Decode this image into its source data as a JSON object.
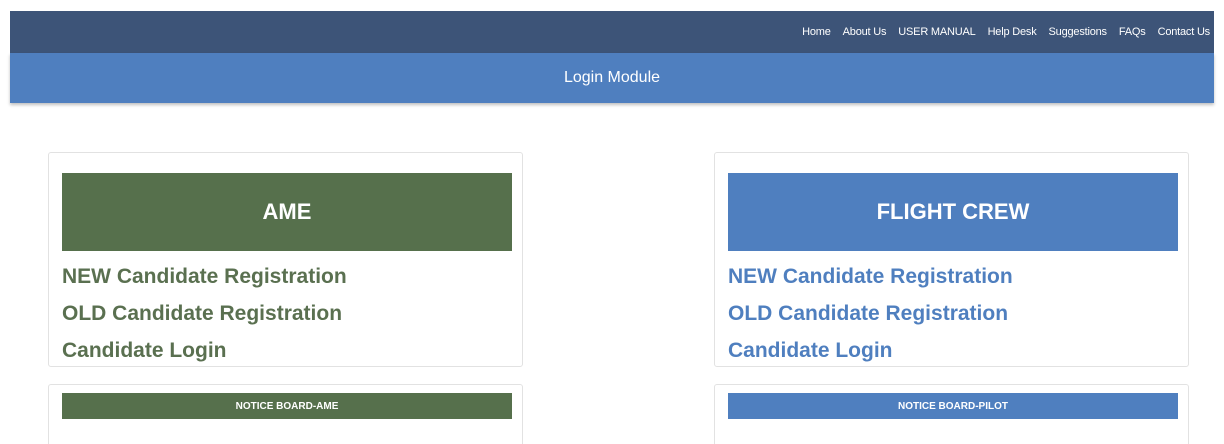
{
  "nav": {
    "items": [
      {
        "label": "Home"
      },
      {
        "label": "About Us"
      },
      {
        "label": "USER MANUAL"
      },
      {
        "label": "Help Desk"
      },
      {
        "label": "Suggestions"
      },
      {
        "label": "FAQs"
      },
      {
        "label": "Contact Us"
      }
    ]
  },
  "module_bar": {
    "title": "Login Module"
  },
  "ame": {
    "title": "AME",
    "links": [
      {
        "label": "NEW Candidate Registration"
      },
      {
        "label": "OLD Candidate Registration"
      },
      {
        "label": "Candidate Login"
      }
    ],
    "notice_title": "NOTICE BOARD-AME"
  },
  "flight_crew": {
    "title": "FLIGHT CREW",
    "links": [
      {
        "label": "NEW Candidate Registration"
      },
      {
        "label": "OLD Candidate Registration"
      },
      {
        "label": "Candidate Login"
      }
    ],
    "notice_title": "NOTICE BOARD-PILOT"
  },
  "colors": {
    "nav_bg": "#3d5478",
    "module_bar_bg": "#4f7fbf",
    "ame_green": "#56704c",
    "flight_blue": "#4f7fbf"
  }
}
